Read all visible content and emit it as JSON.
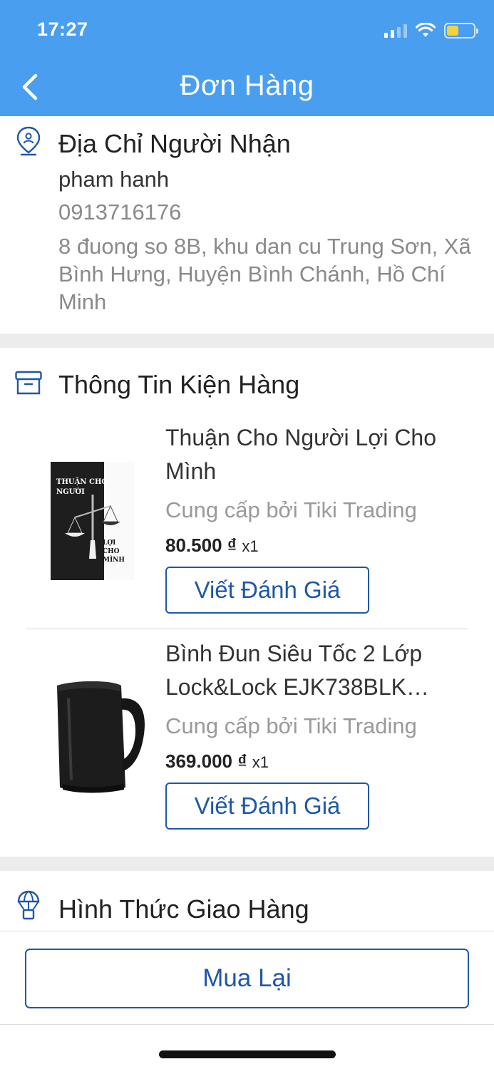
{
  "status_bar": {
    "time": "17:27"
  },
  "header": {
    "title": "Đơn Hàng"
  },
  "address": {
    "title": "Địa Chỉ Người Nhận",
    "name": "pham hanh",
    "phone": "0913716176",
    "line": "8 đuong so 8B, khu dan cu Trung Sơn, Xã Bình Hưng, Huyện Bình Chánh, Hồ Chí Minh"
  },
  "package": {
    "title": "Thông Tin Kiện Hàng",
    "items": [
      {
        "name": "Thuận Cho Người Lợi Cho Mình",
        "seller": "Cung cấp bởi Tiki Trading",
        "price": "80.500 ₫",
        "qty": "x1",
        "review_label": "Viết Đánh Giá",
        "cover_title_top": "THUẬN CHO NGƯỜI",
        "cover_title_bottom": "LỢI CHO MÌNH"
      },
      {
        "name": "Bình Đun Siêu Tốc 2 Lớp Lock&Lock EJK738BLK…",
        "seller": "Cung cấp bởi Tiki Trading",
        "price": "369.000 ₫",
        "qty": "x1",
        "review_label": "Viết Đánh Giá"
      }
    ]
  },
  "delivery": {
    "title": "Hình Thức Giao Hàng"
  },
  "bottom": {
    "rebuy_label": "Mua Lại"
  },
  "colors": {
    "header_bg": "#4a9ef0",
    "accent": "#1f57a6",
    "separator": "#ececec"
  }
}
